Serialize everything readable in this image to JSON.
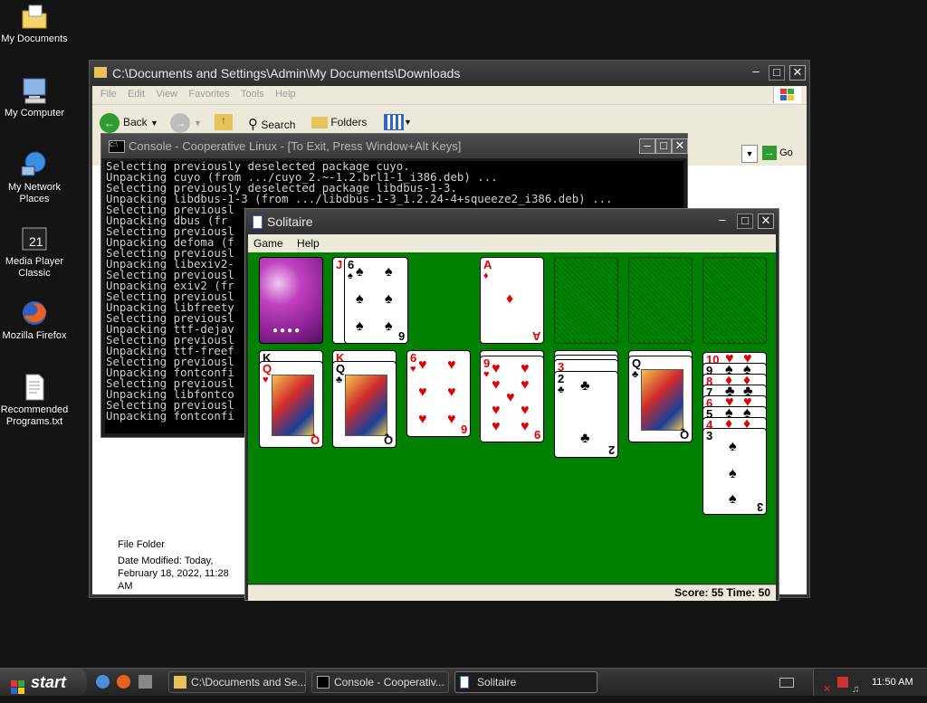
{
  "desktop": {
    "icons": [
      {
        "label": "My Documents"
      },
      {
        "label": "My Computer"
      },
      {
        "label": "My Network Places"
      },
      {
        "label": "Media Player Classic"
      },
      {
        "label": "Mozilla Firefox"
      },
      {
        "label": "Recommended Programs.txt"
      }
    ]
  },
  "explorer": {
    "title": "C:\\Documents and Settings\\Admin\\My Documents\\Downloads",
    "menu": [
      "File",
      "Edit",
      "View",
      "Favorites",
      "Tools",
      "Help"
    ],
    "toolbar": {
      "back": "Back",
      "search": "Search",
      "folders": "Folders"
    },
    "address": {
      "go": "Go"
    },
    "details": {
      "type": "File Folder",
      "modified": "Date Modified: Today, February 18, 2022, 11:28 AM"
    }
  },
  "console": {
    "title": "Console - Cooperative Linux - [To Exit, Press Window+Alt Keys]",
    "lines": [
      "Selecting previously deselected package cuyo.",
      "Unpacking cuyo (from .../cuyo_2.~-1.2.brl1-1_i386.deb) ...",
      "Selecting previously deselected package libdbus-1-3.",
      "Unpacking libdbus-1-3 (from .../libdbus-1-3_1.2.24-4+squeeze2_i386.deb) ...",
      "Selecting previousl",
      "Unpacking dbus (fr",
      "Selecting previousl",
      "Unpacking defoma (f",
      "Selecting previousl",
      "Unpacking libexiv2-",
      "Selecting previousl",
      "Unpacking exiv2 (fr",
      "Selecting previousl",
      "Unpacking libfreety",
      "Selecting previousl",
      "Unpacking ttf-dejav",
      "Selecting previousl",
      "Unpacking ttf-freef",
      "Selecting previousl",
      "Unpacking fontconfi",
      "Selecting previousl",
      "Unpacking libfontco",
      "Selecting previousl",
      "Unpacking fontconfi"
    ]
  },
  "solitaire": {
    "title": "Solitaire",
    "menu": {
      "game": "Game",
      "help": "Help"
    },
    "status": "Score: 55 Time: 50",
    "waste": {
      "under": "J",
      "top": "6"
    },
    "foundation": {
      "ace": "A"
    },
    "tableau": {
      "col1": [
        "K",
        "Q"
      ],
      "col2": [
        "K",
        "Q"
      ],
      "col3": [
        "6"
      ],
      "col4": [
        "9"
      ],
      "col5": [
        "3",
        "2"
      ],
      "col6": [
        "Q"
      ],
      "col7": [
        "10",
        "9",
        "8",
        "7",
        "6",
        "5",
        "4",
        "3"
      ]
    }
  },
  "taskbar": {
    "start": "start",
    "tasks": [
      {
        "label": "C:\\Documents and Se..."
      },
      {
        "label": "Console - Cooperativ..."
      },
      {
        "label": "Solitaire"
      }
    ],
    "clock": "11:50 AM"
  },
  "colors": {
    "felt": "#007f00",
    "card_red": "#e00000",
    "titlebar": "#2d2d2d"
  }
}
